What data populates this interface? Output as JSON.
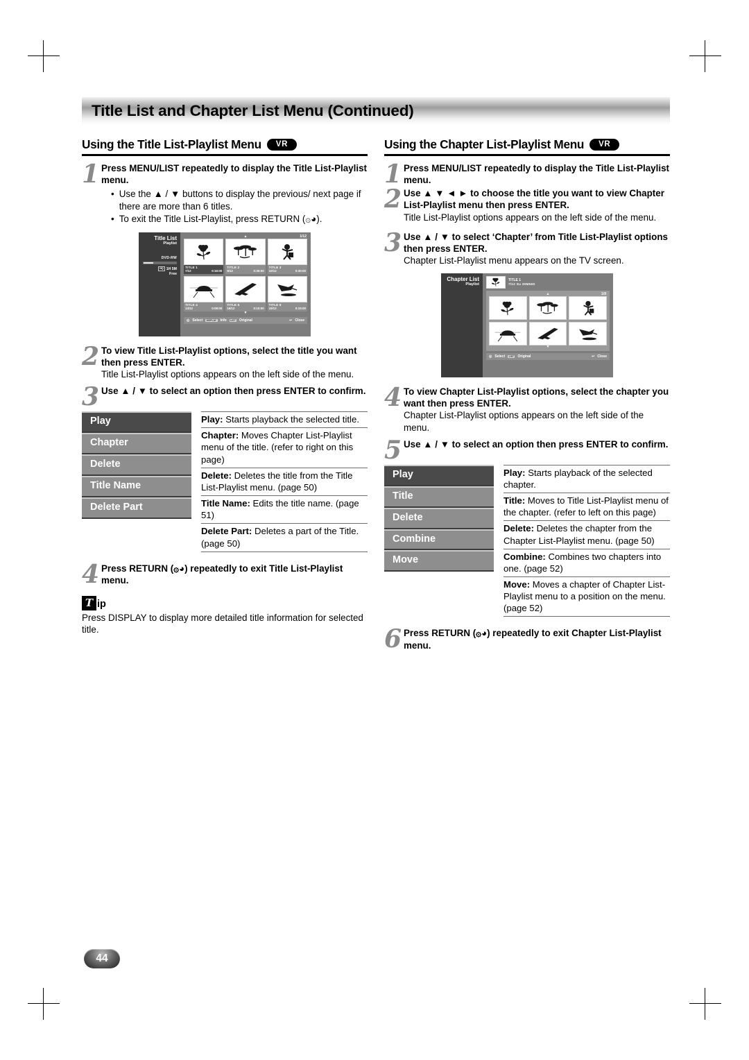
{
  "page": {
    "title": "Title List and Chapter List Menu (Continued)",
    "number": "44"
  },
  "left": {
    "heading": "Using the Title List-Playlist Menu",
    "badge": "VR",
    "steps": [
      {
        "num": "1",
        "title": "Press MENU/LIST repeatedly to display the Title List-Playlist menu.",
        "bullets": [
          "Use the ▲ / ▼ buttons to display the previous/ next page if there are more than 6 titles.",
          "To exit the Title List-Playlist, press RETURN (۞◕)."
        ]
      },
      {
        "num": "2",
        "title": "To view Title List-Playlist options, select the title you want then press ENTER.",
        "desc": "Title List-Playlist options appears on the left side of the menu."
      },
      {
        "num": "3",
        "title": "Use ▲ / ▼ to select an option then press ENTER to confirm."
      },
      {
        "num": "4",
        "title": "Press RETURN (۞◕) repeatedly to exit Title List-Playlist menu."
      }
    ],
    "osd": {
      "title": "Title List",
      "subtitle": "Playlist",
      "disc_type": "DVD-RW",
      "free_label": "1H 5M",
      "free_word": "Free",
      "free_chip": "HQ",
      "page_indicator": "1/12",
      "titles": [
        {
          "name": "TITLE  1",
          "date": "7/12",
          "duration": "0:16:00",
          "selected": true,
          "icon": "rose"
        },
        {
          "name": "TITLE  2",
          "date": "9/12",
          "duration": "0:35:00",
          "selected": false,
          "icon": "trees"
        },
        {
          "name": "TITLE  3",
          "date": "10/12",
          "duration": "0:30:00",
          "selected": false,
          "icon": "figure"
        },
        {
          "name": "TITLE  4",
          "date": "13/12",
          "duration": "0:08:00",
          "selected": false,
          "icon": "car"
        },
        {
          "name": "TITLE  5",
          "date": "16/12",
          "duration": "0:10:00",
          "selected": false,
          "icon": "shuttle"
        },
        {
          "name": "TITLE  6",
          "date": "19/12",
          "duration": "0:15:00",
          "selected": false,
          "icon": "bird"
        }
      ],
      "footer": {
        "select": "Select",
        "display_key": "DISPLAY",
        "info": "Info",
        "list_key": "LIST",
        "original": "Original",
        "close": "Close"
      }
    },
    "options": {
      "menu": [
        "Play",
        "Chapter",
        "Delete",
        "Title Name",
        "Delete Part"
      ],
      "selected": "Play",
      "descriptions": [
        {
          "term": "Play:",
          "text": " Starts playback the selected title."
        },
        {
          "term": "Chapter:",
          "text": " Moves Chapter List-Playlist menu of the title. (refer to right on this page)"
        },
        {
          "term": "Delete:",
          "text": " Deletes the title from the Title List-Playlist menu. (page 50)"
        },
        {
          "term": "Title Name:",
          "text": " Edits the title name. (page 51)"
        },
        {
          "term": "Delete Part:",
          "text": " Deletes a part of the Title. (page 50)"
        }
      ]
    },
    "tip": {
      "t": "T",
      "ip": "ip",
      "body": "Press DISPLAY to display more detailed title information for selected title."
    }
  },
  "right": {
    "heading": "Using the Chapter List-Playlist Menu",
    "badge": "VR",
    "steps": [
      {
        "num": "1",
        "title": "Press MENU/LIST repeatedly to display the Title List-Playlist menu."
      },
      {
        "num": "2",
        "title": "Use ▲ ▼ ◄ ► to choose the title you want to view Chapter List-Playlist menu then press ENTER.",
        "desc": "Title List-Playlist options appears on the left side of the menu."
      },
      {
        "num": "3",
        "title": "Use ▲ / ▼ to select ‘Chapter’ from Title List-Playlist options then press ENTER.",
        "desc": "Chapter List-Playlist menu appears on the TV screen."
      },
      {
        "num": "4",
        "title": "To view Chapter List-Playlist options, select the chapter you want then press ENTER.",
        "desc": "Chapter List-Playlist options appears on the left side of the menu."
      },
      {
        "num": "5",
        "title": "Use ▲ / ▼ to select an option then press ENTER to confirm."
      },
      {
        "num": "6",
        "title": "Press RETURN (۞◕) repeatedly to exit Chapter List-Playlist menu."
      }
    ],
    "osd": {
      "title": "Chapter List",
      "subtitle": "Playlist",
      "header_title": "TITLE 1",
      "header_meta": "7/12  Su    30M56S",
      "page_indicator": "1/9",
      "chapters": [
        "rose",
        "trees",
        "figure",
        "car",
        "shuttle",
        "bird"
      ],
      "footer": {
        "select": "Select",
        "list_key": "LIST",
        "original": "Original",
        "close": "Close"
      }
    },
    "options": {
      "menu": [
        "Play",
        "Title",
        "Delete",
        "Combine",
        "Move"
      ],
      "selected": "Play",
      "descriptions": [
        {
          "term": "Play:",
          "text": " Starts playback of the selected chapter."
        },
        {
          "term": "Title:",
          "text": " Moves to Title List-Playlist menu of the chapter. (refer to left on this page)"
        },
        {
          "term": "Delete:",
          "text": " Deletes the chapter from the Chapter List-Playlist menu. (page 50)"
        },
        {
          "term": "Combine:",
          "text": " Combines two chapters into one. (page 52)"
        },
        {
          "term": "Move:",
          "text": " Moves a chapter of Chapter List-Playlist menu to a position on the menu. (page 52)"
        }
      ]
    }
  }
}
